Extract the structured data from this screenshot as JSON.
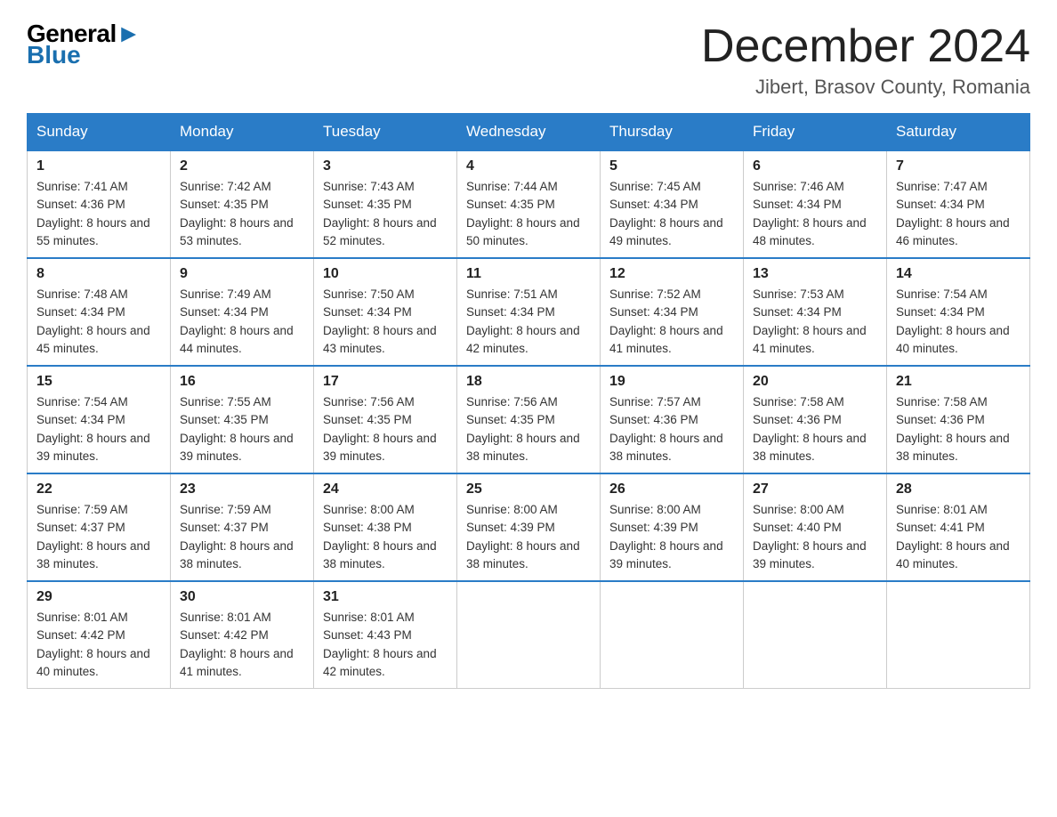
{
  "header": {
    "logo_general": "General",
    "logo_blue": "Blue",
    "month_title": "December 2024",
    "location": "Jibert, Brasov County, Romania"
  },
  "days_of_week": [
    "Sunday",
    "Monday",
    "Tuesday",
    "Wednesday",
    "Thursday",
    "Friday",
    "Saturday"
  ],
  "weeks": [
    [
      {
        "day": "1",
        "sunrise": "7:41 AM",
        "sunset": "4:36 PM",
        "daylight": "8 hours and 55 minutes."
      },
      {
        "day": "2",
        "sunrise": "7:42 AM",
        "sunset": "4:35 PM",
        "daylight": "8 hours and 53 minutes."
      },
      {
        "day": "3",
        "sunrise": "7:43 AM",
        "sunset": "4:35 PM",
        "daylight": "8 hours and 52 minutes."
      },
      {
        "day": "4",
        "sunrise": "7:44 AM",
        "sunset": "4:35 PM",
        "daylight": "8 hours and 50 minutes."
      },
      {
        "day": "5",
        "sunrise": "7:45 AM",
        "sunset": "4:34 PM",
        "daylight": "8 hours and 49 minutes."
      },
      {
        "day": "6",
        "sunrise": "7:46 AM",
        "sunset": "4:34 PM",
        "daylight": "8 hours and 48 minutes."
      },
      {
        "day": "7",
        "sunrise": "7:47 AM",
        "sunset": "4:34 PM",
        "daylight": "8 hours and 46 minutes."
      }
    ],
    [
      {
        "day": "8",
        "sunrise": "7:48 AM",
        "sunset": "4:34 PM",
        "daylight": "8 hours and 45 minutes."
      },
      {
        "day": "9",
        "sunrise": "7:49 AM",
        "sunset": "4:34 PM",
        "daylight": "8 hours and 44 minutes."
      },
      {
        "day": "10",
        "sunrise": "7:50 AM",
        "sunset": "4:34 PM",
        "daylight": "8 hours and 43 minutes."
      },
      {
        "day": "11",
        "sunrise": "7:51 AM",
        "sunset": "4:34 PM",
        "daylight": "8 hours and 42 minutes."
      },
      {
        "day": "12",
        "sunrise": "7:52 AM",
        "sunset": "4:34 PM",
        "daylight": "8 hours and 41 minutes."
      },
      {
        "day": "13",
        "sunrise": "7:53 AM",
        "sunset": "4:34 PM",
        "daylight": "8 hours and 41 minutes."
      },
      {
        "day": "14",
        "sunrise": "7:54 AM",
        "sunset": "4:34 PM",
        "daylight": "8 hours and 40 minutes."
      }
    ],
    [
      {
        "day": "15",
        "sunrise": "7:54 AM",
        "sunset": "4:34 PM",
        "daylight": "8 hours and 39 minutes."
      },
      {
        "day": "16",
        "sunrise": "7:55 AM",
        "sunset": "4:35 PM",
        "daylight": "8 hours and 39 minutes."
      },
      {
        "day": "17",
        "sunrise": "7:56 AM",
        "sunset": "4:35 PM",
        "daylight": "8 hours and 39 minutes."
      },
      {
        "day": "18",
        "sunrise": "7:56 AM",
        "sunset": "4:35 PM",
        "daylight": "8 hours and 38 minutes."
      },
      {
        "day": "19",
        "sunrise": "7:57 AM",
        "sunset": "4:36 PM",
        "daylight": "8 hours and 38 minutes."
      },
      {
        "day": "20",
        "sunrise": "7:58 AM",
        "sunset": "4:36 PM",
        "daylight": "8 hours and 38 minutes."
      },
      {
        "day": "21",
        "sunrise": "7:58 AM",
        "sunset": "4:36 PM",
        "daylight": "8 hours and 38 minutes."
      }
    ],
    [
      {
        "day": "22",
        "sunrise": "7:59 AM",
        "sunset": "4:37 PM",
        "daylight": "8 hours and 38 minutes."
      },
      {
        "day": "23",
        "sunrise": "7:59 AM",
        "sunset": "4:37 PM",
        "daylight": "8 hours and 38 minutes."
      },
      {
        "day": "24",
        "sunrise": "8:00 AM",
        "sunset": "4:38 PM",
        "daylight": "8 hours and 38 minutes."
      },
      {
        "day": "25",
        "sunrise": "8:00 AM",
        "sunset": "4:39 PM",
        "daylight": "8 hours and 38 minutes."
      },
      {
        "day": "26",
        "sunrise": "8:00 AM",
        "sunset": "4:39 PM",
        "daylight": "8 hours and 39 minutes."
      },
      {
        "day": "27",
        "sunrise": "8:00 AM",
        "sunset": "4:40 PM",
        "daylight": "8 hours and 39 minutes."
      },
      {
        "day": "28",
        "sunrise": "8:01 AM",
        "sunset": "4:41 PM",
        "daylight": "8 hours and 40 minutes."
      }
    ],
    [
      {
        "day": "29",
        "sunrise": "8:01 AM",
        "sunset": "4:42 PM",
        "daylight": "8 hours and 40 minutes."
      },
      {
        "day": "30",
        "sunrise": "8:01 AM",
        "sunset": "4:42 PM",
        "daylight": "8 hours and 41 minutes."
      },
      {
        "day": "31",
        "sunrise": "8:01 AM",
        "sunset": "4:43 PM",
        "daylight": "8 hours and 42 minutes."
      },
      null,
      null,
      null,
      null
    ]
  ]
}
